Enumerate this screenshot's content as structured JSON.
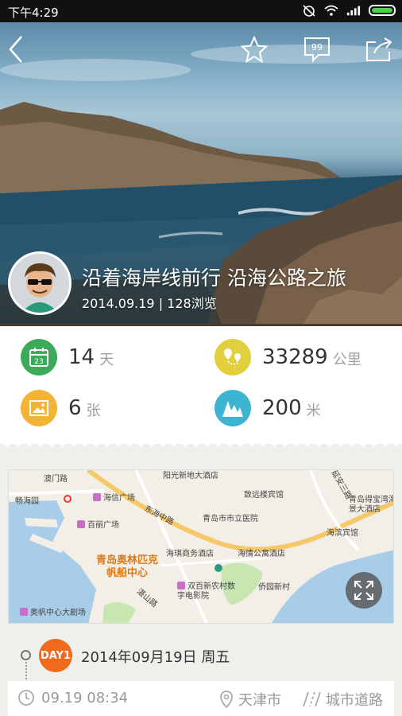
{
  "statusbar": {
    "time": "下午4:29"
  },
  "trip": {
    "title": "沿着海岸线前行 沿海公路之旅",
    "meta": "2014.09.19 | 128浏览"
  },
  "stats": {
    "days": {
      "value": "14",
      "unit": "天",
      "icon": "calendar-icon",
      "color": "#3bab5a",
      "icon_text": "23"
    },
    "distance": {
      "value": "33289",
      "unit": "公里",
      "icon": "route-pin-icon",
      "color": "#e2cf3d"
    },
    "photos": {
      "value": "6",
      "unit": "张",
      "icon": "photo-icon",
      "color": "#f4b335"
    },
    "altitude": {
      "value": "200",
      "unit": "米",
      "icon": "mountain-icon",
      "color": "#3cb4d2"
    }
  },
  "map": {
    "labels": [
      "阳光新地大酒店",
      "致远楼宾馆",
      "青岛得宝湾海景大酒店",
      "澳门路",
      "畅海园",
      "海信广场",
      "东海中路",
      "青岛市市立医院",
      "百丽广场",
      "海滨宾馆",
      "海琪商务酒店",
      "海情公寓酒店",
      "侨园新村",
      "双百新农村数字电影院",
      "奥帆中心大剧场",
      "湛山路",
      "延安三路"
    ],
    "highlight": "青岛奥林匹克帆船中心"
  },
  "day": {
    "badge": "DAY1",
    "date": "2014年09月19日  周五"
  },
  "entry": {
    "time": "09.19  08:34",
    "city": "天津市",
    "road": "城市道路"
  },
  "colors": {
    "accent": "#f06a1c"
  }
}
